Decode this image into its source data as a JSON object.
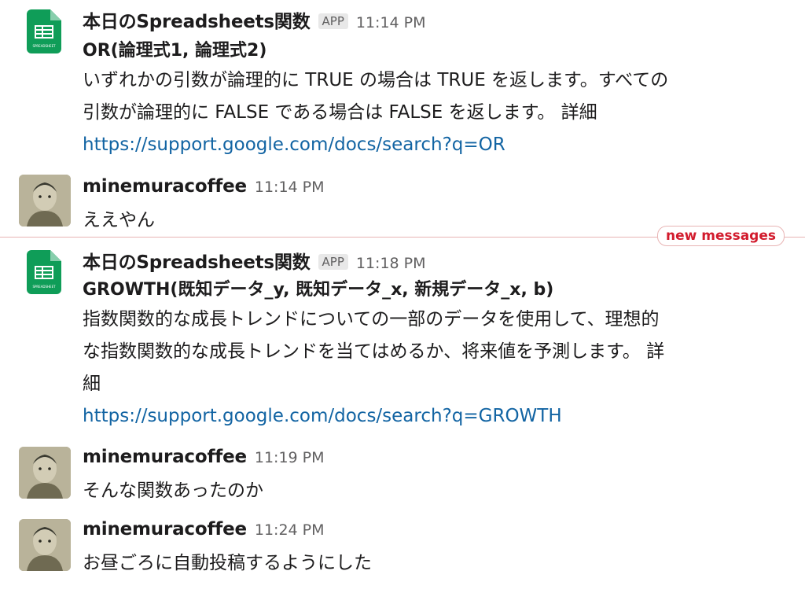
{
  "messages": [
    {
      "author": "本日のSpreadsheets関数",
      "badge": "APP",
      "time": "11:14 PM",
      "formula": "OR(論理式1, 論理式2)",
      "body_lines": [
        "いずれかの引数が論理的に TRUE の場合は TRUE を返します。すべての",
        "引数が論理的に FALSE である場合は FALSE を返します。 詳細"
      ],
      "link": "https://support.google.com/docs/search?q=OR"
    },
    {
      "author": "minemuracoffee",
      "time": "11:14 PM",
      "body": "ええやん"
    },
    {
      "author": "本日のSpreadsheets関数",
      "badge": "APP",
      "time": "11:18 PM",
      "formula": "GROWTH(既知データ_y, 既知データ_x, 新規データ_x, b)",
      "body_lines": [
        "指数関数的な成長トレンドについての一部のデータを使用して、理想的",
        "な指数関数的な成長トレンドを当てはめるか、将来値を予測します。 詳",
        "細"
      ],
      "link": "https://support.google.com/docs/search?q=GROWTH"
    },
    {
      "author": "minemuracoffee",
      "time": "11:19 PM",
      "body": "そんな関数あったのか"
    },
    {
      "author": "minemuracoffee",
      "time": "11:24 PM",
      "body": "お昼ごろに自動投稿するようにした"
    }
  ],
  "divider": {
    "label": "new messages"
  },
  "icons": {
    "app_avatar": "spreadsheet-icon",
    "app_avatar_label": "SPREADSHEET",
    "user_avatar": "user-photo"
  },
  "colors": {
    "link": "#1264a3",
    "new_messages": "#d21b2d",
    "sheets_green": "#0f9d58"
  }
}
